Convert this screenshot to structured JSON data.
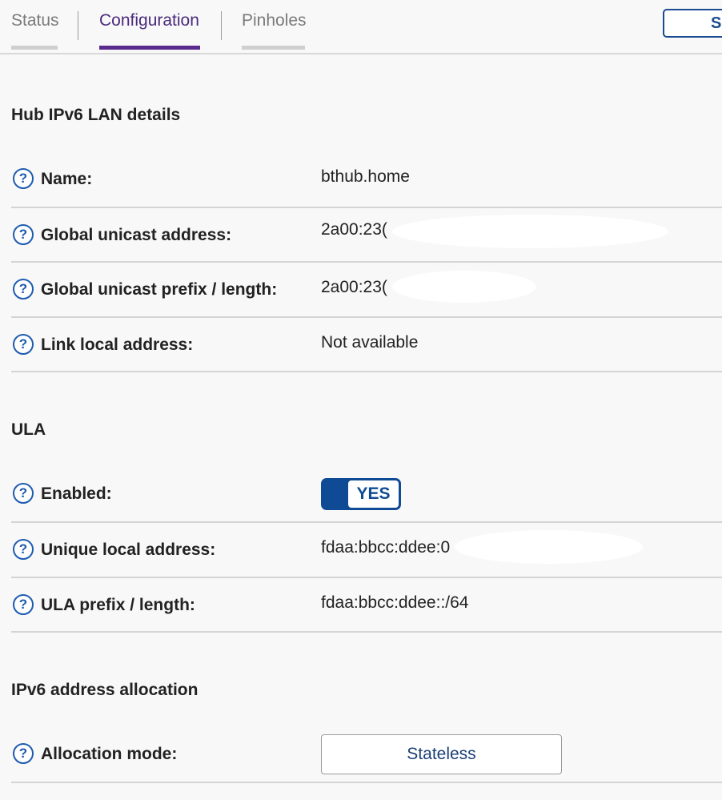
{
  "tabs": [
    {
      "label": "Status",
      "active": false
    },
    {
      "label": "Configuration",
      "active": true
    },
    {
      "label": "Pinholes",
      "active": false
    }
  ],
  "save_button": {
    "label": "S"
  },
  "help_glyph": "?",
  "sections": {
    "hub_lan": {
      "title": "Hub IPv6 LAN details",
      "rows": [
        {
          "label": "Name:",
          "value": "bthub.home"
        },
        {
          "label": "Global unicast address:",
          "value": "2a00:23("
        },
        {
          "label": "Global unicast prefix / length:",
          "value": "2a00:23("
        },
        {
          "label": "Link local address:",
          "value": "Not available"
        }
      ]
    },
    "ula": {
      "title": "ULA",
      "enabled": {
        "label": "Enabled:",
        "toggle": "YES"
      },
      "rows": [
        {
          "label": "Unique local address:",
          "value": "fdaa:bbcc:ddee:0"
        },
        {
          "label": "ULA prefix / length:",
          "value": "fdaa:bbcc:ddee::/64"
        }
      ]
    },
    "allocation": {
      "title": "IPv6 address allocation",
      "mode": {
        "label": "Allocation mode:",
        "value": "Stateless"
      }
    }
  },
  "colors": {
    "accent_purple": "#5a2b8d",
    "toggle_blue": "#0f4b94",
    "help_blue": "#1e5bb0",
    "page_bg": "#f8f8f8"
  }
}
